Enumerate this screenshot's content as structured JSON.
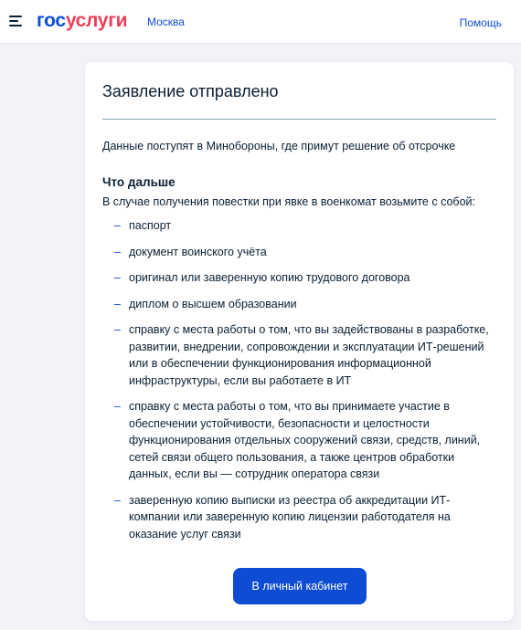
{
  "header": {
    "logo_part1": "гос",
    "logo_part2": "услуги",
    "city": "Москва",
    "help": "Помощь"
  },
  "card": {
    "title": "Заявление отправлено",
    "info": "Данные поступят в Минобороны, где примут решение об отсрочке",
    "subtitle": "Что дальше",
    "lead": "В случае получения повестки при явке в военкомат возьмите с собой:",
    "dash": "–",
    "items": [
      "паспорт",
      "документ воинского учёта",
      "оригинал или заверенную копию трудового договора",
      "диплом о высшем образовании",
      "справку с места работы о том, что вы задействованы в разработке, развитии, внедрении, сопровождении и эксплуатации ИТ-решений или в обеспечении функционирования информационной инфраструктуры, если вы работаете в ИТ",
      "справку с места работы о том, что вы принимаете участие в обеспечении устойчивости, безопасности и целостности функционирования отдельных сооружений связи, средств, линий, сетей связи общего пользования, а также центров обработки данных, если вы — сотрудник оператора связи",
      "заверенную копию выписки из реестра об аккредитации ИТ-компании или заверенную копию лицензии работодателя на оказание услуг связи"
    ],
    "button": "В личный кабинет"
  },
  "colors": {
    "brand_blue": "#0d4cd3",
    "brand_red": "#ee3f58",
    "text": "#0b1f33",
    "background": "#f1f3f7"
  },
  "icons": {
    "menu": "hamburger-menu-icon"
  }
}
